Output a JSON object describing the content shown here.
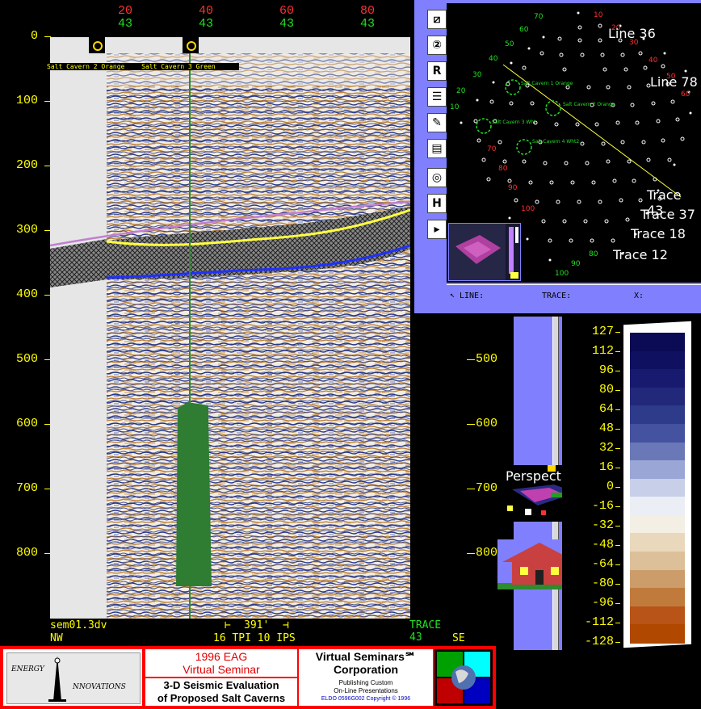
{
  "seismic": {
    "top_axis_red": [
      "20",
      "40",
      "60",
      "80"
    ],
    "top_axis_green": [
      "43",
      "43",
      "43",
      "43"
    ],
    "depth_labels": [
      "0",
      "100",
      "200",
      "300",
      "400",
      "500",
      "600",
      "700",
      "800"
    ],
    "right_depth_labels": [
      "500",
      "600",
      "700",
      "800"
    ],
    "cavern_labels": [
      "Salt Cavern 2 Orange",
      "Salt Cavern 3 Green"
    ],
    "file_name": "sem01.3dv",
    "scale_text": "391'",
    "scale_sub": "16 TPI 10 IPS",
    "trace_label": "TRACE 43",
    "dir_left": "NW",
    "dir_right": "SE"
  },
  "map": {
    "labels": [
      "Line 36",
      "Line 78",
      "Trace 43",
      "Trace 37",
      "Trace 18",
      "Trace 12"
    ],
    "green_numbers": [
      "70",
      "60",
      "50",
      "40",
      "30",
      "20",
      "10",
      "80",
      "90",
      "100"
    ],
    "red_numbers": [
      "10",
      "20",
      "30",
      "40",
      "50",
      "60",
      "70",
      "80",
      "90",
      "100"
    ],
    "cavern_tags": [
      "Salt Cavern 1 Orange",
      "Salt Cavern 2 Orange",
      "Salt Cavern 3 Wht",
      "Salt Cavern 4 Wht2"
    ],
    "status": {
      "line_label": "LINE:",
      "trace_label": "TRACE:",
      "x_label": "X:"
    },
    "toolbar_buttons": [
      "zoom-tool",
      "rotate-tool",
      "reset-tool",
      "list-tool",
      "palette-tool",
      "script-tool",
      "orbit-tool",
      "help-tool",
      "print-tool"
    ],
    "toolbar_glyphs": [
      "⧄",
      "②",
      "R",
      "☰",
      "✎",
      "▤",
      "◎",
      "H",
      "▸"
    ]
  },
  "colorbar": {
    "labels": [
      "127",
      "112",
      "96",
      "80",
      "64",
      "48",
      "32",
      "16",
      "0",
      "-16",
      "-32",
      "-48",
      "-64",
      "-80",
      "-96",
      "-112",
      "-128"
    ],
    "swatches": [
      "#0a0a55",
      "#0f1060",
      "#181a70",
      "#22287a",
      "#2e3a8a",
      "#4452a0",
      "#6a78b8",
      "#9aa6d6",
      "#c8cfe8",
      "#eceef5",
      "#f4efe4",
      "#ead8bc",
      "#dcc09a",
      "#cc9c6a",
      "#c07a3c",
      "#b85418",
      "#b04800"
    ]
  },
  "nav": {
    "perspective_label": "Perspective"
  },
  "footer": {
    "logo_text_top": "ENERGY",
    "logo_text_bottom": "NNOVATIONS",
    "eag_line1": "1996 EAG",
    "eag_line2": "Virtual Seminar",
    "eval_line1": "3-D Seismic Evaluation",
    "eval_line2": "of Proposed Salt Caverns",
    "vs_line1": "Virtual Seminars℠",
    "vs_line2": "Corporation",
    "vs_small1": "Publishing Custom",
    "vs_small2": "On-Line Presentations",
    "vs_small3": "ELDO 0596G002 Copyright © 1996"
  },
  "colors": {
    "yellow": "#ffff00",
    "red": "#ff3030",
    "green": "#20e020",
    "panel_blue": "#8080ff",
    "cavern_green": "#2e7d32"
  }
}
